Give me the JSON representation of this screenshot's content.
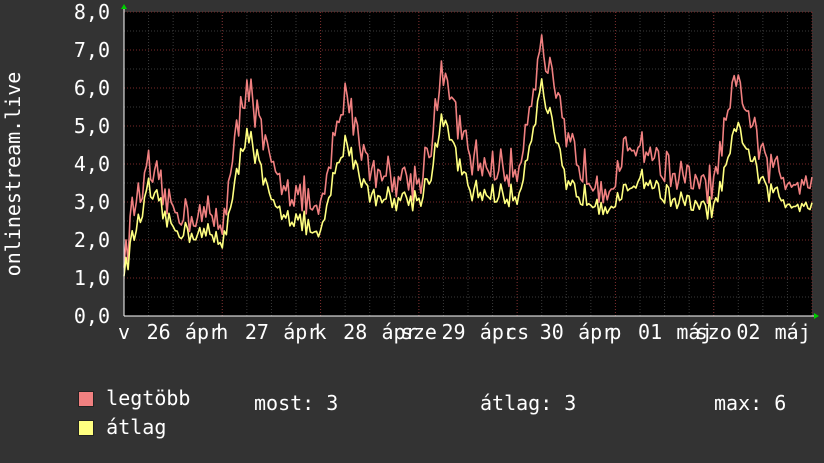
{
  "chart_data": {
    "type": "line",
    "title": "",
    "ylabel": "onlinestream.live",
    "xlabel": "",
    "ylim": [
      0,
      8
    ],
    "yticks": [
      "0,0",
      "1,0",
      "2,0",
      "3,0",
      "4,0",
      "5,0",
      "6,0",
      "7,0",
      "8,0"
    ],
    "xtick_labels": [
      "v",
      "26",
      "ápr",
      "h",
      "27",
      "ápr",
      "k",
      "28",
      "ápr",
      "sze",
      "29",
      "ápr",
      "cs",
      "30",
      "ápr",
      "p",
      "01",
      "máj",
      "szo",
      "02",
      "máj"
    ],
    "grid": true,
    "colors": {
      "background": "#333333",
      "plot": "#000000",
      "grid_minor": "#3a3a3a",
      "grid_major": "#7a2a2a",
      "max_series": "#f08080",
      "avg_series": "#ffff80",
      "text": "#ffffff",
      "arrow": "#00cc00"
    },
    "series": [
      {
        "name": "legtöbb",
        "color": "#f08080",
        "x": [
          0.0,
          0.11,
          0.25,
          0.5,
          0.75,
          1.0,
          1.1,
          1.25,
          1.5,
          1.75,
          2.0,
          2.1,
          2.25,
          2.5,
          2.75,
          3.0,
          3.1,
          3.25,
          3.5,
          3.75,
          4.0,
          4.1,
          4.25,
          4.5,
          4.75,
          5.0,
          5.1,
          5.25,
          5.5,
          5.75,
          6.0,
          6.1,
          6.25,
          6.5,
          6.75,
          7.0
        ],
        "values": [
          1.5,
          3.0,
          3.8,
          2.8,
          2.7,
          2.5,
          4.0,
          6.3,
          3.8,
          3.3,
          2.6,
          4.1,
          5.9,
          3.9,
          3.7,
          3.6,
          4.4,
          6.4,
          4.2,
          3.9,
          3.8,
          5.2,
          7.2,
          4.6,
          3.7,
          3.4,
          4.3,
          4.6,
          3.9,
          3.5,
          3.4,
          4.7,
          6.2,
          4.1,
          3.6,
          3.7
        ]
      },
      {
        "name": "átlag",
        "color": "#ffff80",
        "x": [
          0.0,
          0.11,
          0.25,
          0.5,
          0.75,
          1.0,
          1.1,
          1.25,
          1.5,
          1.75,
          2.0,
          2.1,
          2.25,
          2.5,
          2.75,
          3.0,
          3.1,
          3.25,
          3.5,
          3.75,
          4.0,
          4.1,
          4.25,
          4.5,
          4.75,
          5.0,
          5.1,
          5.25,
          5.5,
          5.75,
          6.0,
          6.1,
          6.25,
          6.5,
          6.75,
          7.0
        ],
        "values": [
          1.2,
          2.2,
          3.3,
          2.3,
          2.2,
          2.0,
          3.0,
          5.0,
          2.9,
          2.6,
          2.0,
          3.3,
          4.6,
          3.2,
          3.1,
          3.1,
          3.6,
          5.2,
          3.3,
          3.2,
          3.1,
          4.2,
          6.1,
          3.4,
          3.1,
          2.9,
          3.2,
          3.7,
          3.2,
          2.9,
          2.8,
          3.6,
          5.0,
          3.4,
          3.0,
          3.0
        ]
      }
    ]
  },
  "legend": {
    "items": [
      {
        "label": "legtöbb",
        "color": "#f08080"
      },
      {
        "label": "átlag",
        "color": "#ffff80"
      }
    ]
  },
  "stats": {
    "most": "most: 3",
    "atlag": "átlag: 3",
    "max": "max: 6"
  }
}
